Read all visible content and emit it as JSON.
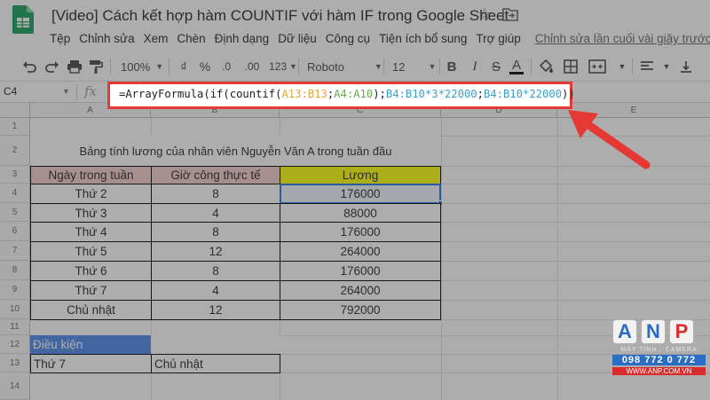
{
  "window": {
    "title": "[Video] Cách kết hợp hàm COUNTIF với hàm IF trong Google Sheet"
  },
  "menu": {
    "items": [
      "Tệp",
      "Chỉnh sửa",
      "Xem",
      "Chèn",
      "Định dạng",
      "Dữ liệu",
      "Công cụ",
      "Tiện ích bổ sung",
      "Trợ giúp"
    ],
    "last_edit": "Chỉnh sửa lần cuối vài giây trước"
  },
  "toolbar": {
    "zoom": "100%",
    "currency": "₫",
    "percent": "%",
    "decimal_less": ".0",
    "decimal_more": ".00",
    "number_format": "123",
    "font": "Roboto",
    "font_size": "12",
    "bold": "B",
    "italic": "I",
    "strike": "S",
    "text_color": "A"
  },
  "formula_bar": {
    "name_box": "C4",
    "fx": "fx",
    "formula": {
      "p1": "=ArrayFormula(if(countif(",
      "r1": "A13:B13",
      "p2": ";",
      "r2": "A4:A10",
      "p3": ");",
      "r3": "B4:B10*3*22000",
      "p4": ";",
      "r4": "B4:B10*22000",
      "p5": "))"
    }
  },
  "grid": {
    "columns": [
      "A",
      "B",
      "C",
      "D",
      "E"
    ],
    "rows": [
      "1",
      "2",
      "3",
      "4",
      "5",
      "6",
      "7",
      "8",
      "9",
      "10",
      "11",
      "12",
      "13",
      "14"
    ]
  },
  "sheet": {
    "title": "Bảng tính lương của nhân viên Nguyễn Văn A trong tuần đầu",
    "headers": [
      "Ngày trong tuần",
      "Giờ công thực tế",
      "Lương"
    ],
    "rows": [
      [
        "Thứ 2",
        "8",
        "176000"
      ],
      [
        "Thứ 3",
        "4",
        "88000"
      ],
      [
        "Thứ 4",
        "8",
        "176000"
      ],
      [
        "Thứ 5",
        "12",
        "264000"
      ],
      [
        "Thứ 6",
        "8",
        "176000"
      ],
      [
        "Thứ 7",
        "4",
        "264000"
      ],
      [
        "Chủ nhật",
        "12",
        "792000"
      ]
    ],
    "condition_label": "Điều kiện",
    "condition_values": [
      "Thứ 7",
      "Chủ nhật"
    ]
  },
  "watermark": {
    "letters": [
      "A",
      "N",
      "P"
    ],
    "tagline": "MÁY TÍNH · CAMERA",
    "phone": "098 772 0 772",
    "website": "WWW.ANP.COM.VN"
  },
  "colors": {
    "header_pink": "#f4cccc",
    "header_yellow": "#ffff00",
    "condition_blue": "#4a86e8",
    "annotation_red": "#e53935",
    "selection_blue": "#1a73e8"
  }
}
